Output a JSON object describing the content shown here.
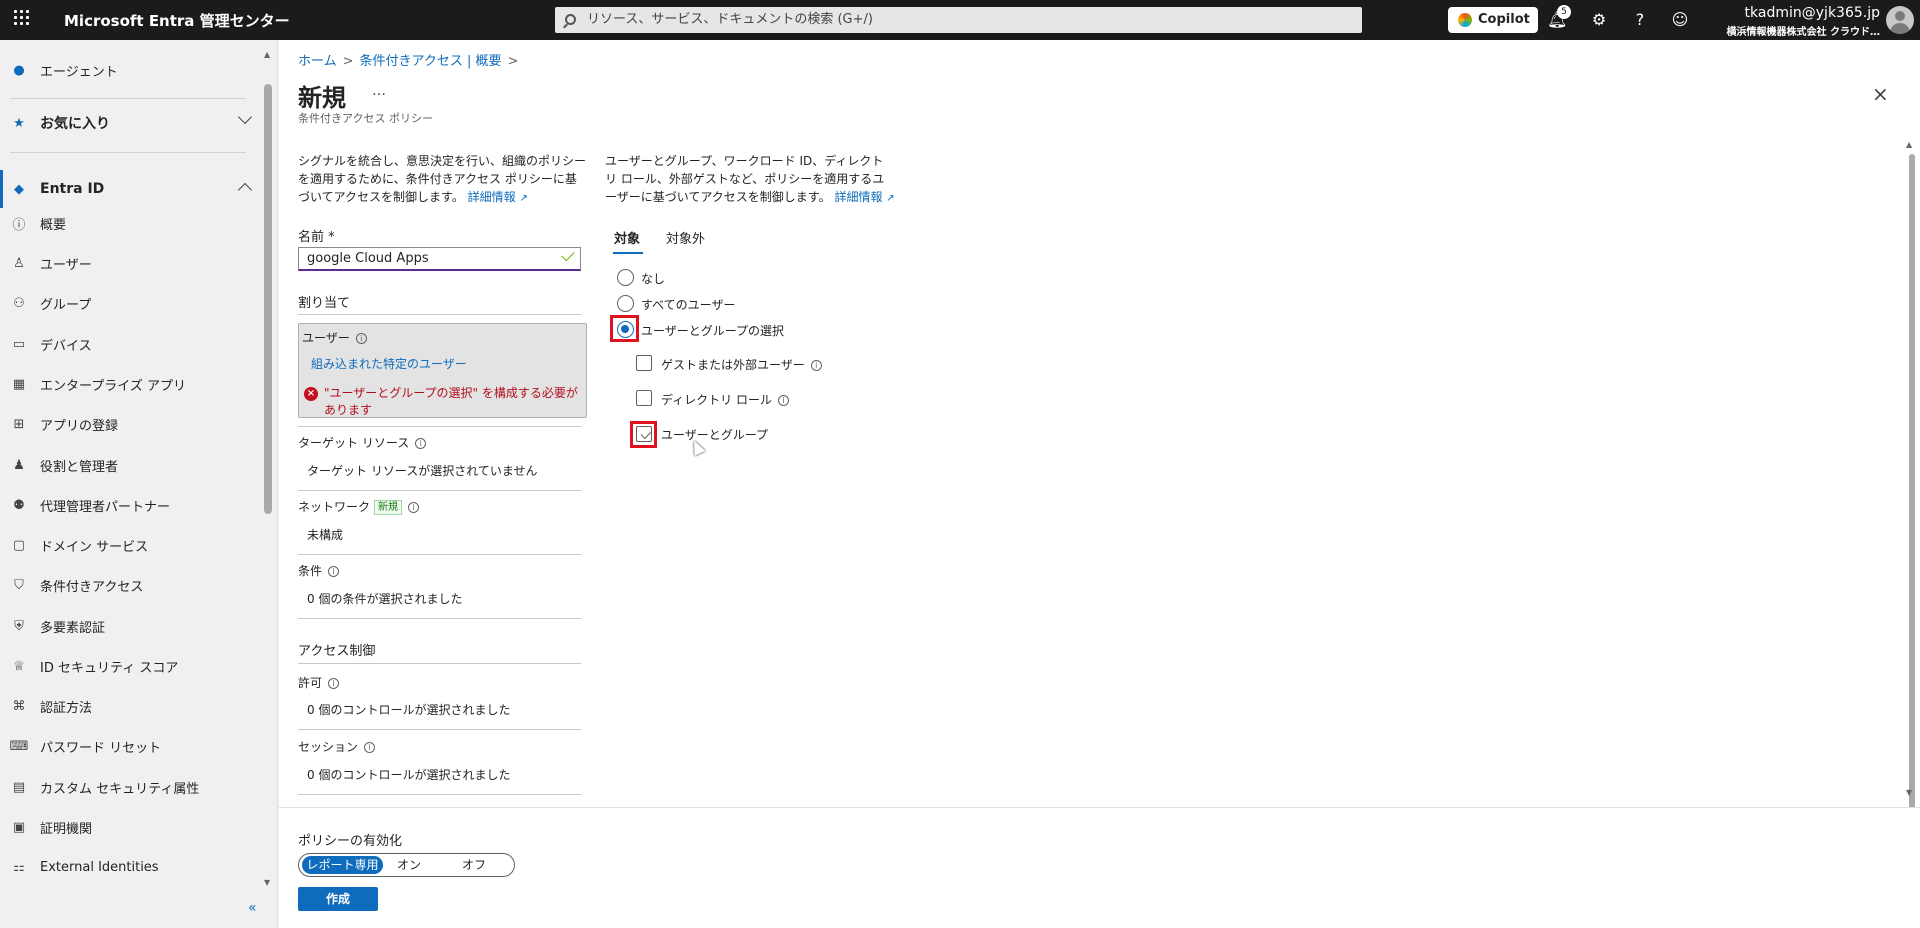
{
  "topbar": {
    "brand": "Microsoft Entra 管理センター",
    "search_placeholder": "リソース、サービス、ドキュメントの検索 (G+/)",
    "copilot_label": "Copilot",
    "notification_count": "5",
    "user_email": "tkadmin@yjk365.jp",
    "user_org": "横浜情報機器株式会社 クラウド…"
  },
  "sidebar": {
    "items": [
      {
        "label": "エージェント"
      },
      {
        "label": "お気に入り"
      },
      {
        "label": "Entra ID"
      },
      {
        "label": "概要"
      },
      {
        "label": "ユーザー"
      },
      {
        "label": "グループ"
      },
      {
        "label": "デバイス"
      },
      {
        "label": "エンタープライズ アプリ"
      },
      {
        "label": "アプリの登録"
      },
      {
        "label": "役割と管理者"
      },
      {
        "label": "代理管理者パートナー"
      },
      {
        "label": "ドメイン サービス"
      },
      {
        "label": "条件付きアクセス"
      },
      {
        "label": "多要素認証"
      },
      {
        "label": "ID セキュリティ スコア"
      },
      {
        "label": "認証方法"
      },
      {
        "label": "パスワード リセット"
      },
      {
        "label": "カスタム セキュリティ属性"
      },
      {
        "label": "証明機関"
      },
      {
        "label": "External Identities"
      }
    ],
    "collapse_glyph": "«"
  },
  "breadcrumb": {
    "items": [
      "ホーム",
      "条件付きアクセス | 概要"
    ]
  },
  "page": {
    "title": "新規",
    "more": "…",
    "subtitle": "条件付きアクセス ポリシー",
    "close": "×"
  },
  "left_panel": {
    "description": "シグナルを統合し、意思決定を行い、組織のポリシーを適用するために、条件付きアクセス ポリシーに基づいてアクセスを制御します。",
    "learn_more": "詳細情報",
    "name_label": "名前 *",
    "name_value": "google Cloud Apps",
    "assignments_heading": "割り当て",
    "users_label": "ユーザー",
    "users_value": "組み込まれた特定のユーザー",
    "users_error": "\"ユーザーとグループの選択\" を構成する必要があります",
    "target_label": "ターゲット リソース",
    "target_value": "ターゲット リソースが選択されていません",
    "network_label": "ネットワーク",
    "network_badge": "新規",
    "network_value": "未構成",
    "conditions_label": "条件",
    "conditions_value": "0 個の条件が選択されました",
    "access_controls_heading": "アクセス制御",
    "grant_label": "許可",
    "grant_value": "0 個のコントロールが選択されました",
    "session_label": "セッション",
    "session_value": "0 個のコントロールが選択されました"
  },
  "right_panel": {
    "description": "ユーザーとグループ、ワークロード ID、ディレクトリ ロール、外部ゲストなど、ポリシーを適用するユーザーに基づいてアクセスを制御します。",
    "learn_more": "詳細情報",
    "tabs": [
      {
        "label": "対象",
        "active": true
      },
      {
        "label": "対象外",
        "active": false
      }
    ],
    "radios": [
      {
        "label": "なし",
        "checked": false
      },
      {
        "label": "すべてのユーザー",
        "checked": false
      },
      {
        "label": "ユーザーとグループの選択",
        "checked": true
      }
    ],
    "checkboxes": [
      {
        "label": "ゲストまたは外部ユーザー",
        "checked": false
      },
      {
        "label": "ディレクトリ ロール",
        "checked": false
      },
      {
        "label": "ユーザーとグループ",
        "checked": true
      }
    ]
  },
  "footer": {
    "enable_label": "ポリシーの有効化",
    "toggle_options": [
      "レポート専用",
      "オン",
      "オフ"
    ],
    "toggle_selected": "レポート専用",
    "create_label": "作成"
  },
  "colors": {
    "accent": "#0f6cbd",
    "error": "#c50f1f",
    "highlight": "#e0121f",
    "topbar": "#1b1b1b"
  }
}
